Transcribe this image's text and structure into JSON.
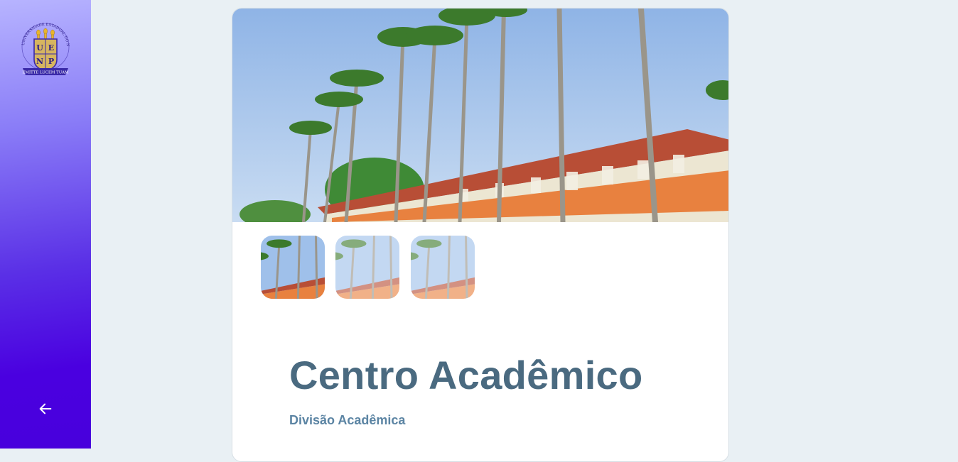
{
  "sidebar": {
    "logo": {
      "icon": "uenp-crest-logo",
      "letters": [
        "U",
        "E",
        "N",
        "P"
      ],
      "ring_text": "UNIVERSIDADE ESTADUAL DO NORTE DO PARANÁ",
      "banner_text": "EMITTE LUCEM TUAM"
    },
    "back_icon": "arrow-left-icon"
  },
  "gallery": {
    "main_image": "campus-building-palm-trees-photo",
    "thumbnails": [
      {
        "image": "campus-building-palm-trees-photo",
        "selected": true
      },
      {
        "image": "campus-building-palm-trees-photo",
        "selected": false
      },
      {
        "image": "campus-building-palm-trees-photo",
        "selected": false
      }
    ]
  },
  "page": {
    "title": "Centro Acadêmico",
    "subtitle": "Divisão Acadêmica"
  },
  "colors": {
    "sidebar_top": "#b7b4ff",
    "sidebar_bottom": "#4800dc",
    "background": "#e9f0f4",
    "title": "#4a6a80",
    "subtitle": "#5b84a3"
  }
}
